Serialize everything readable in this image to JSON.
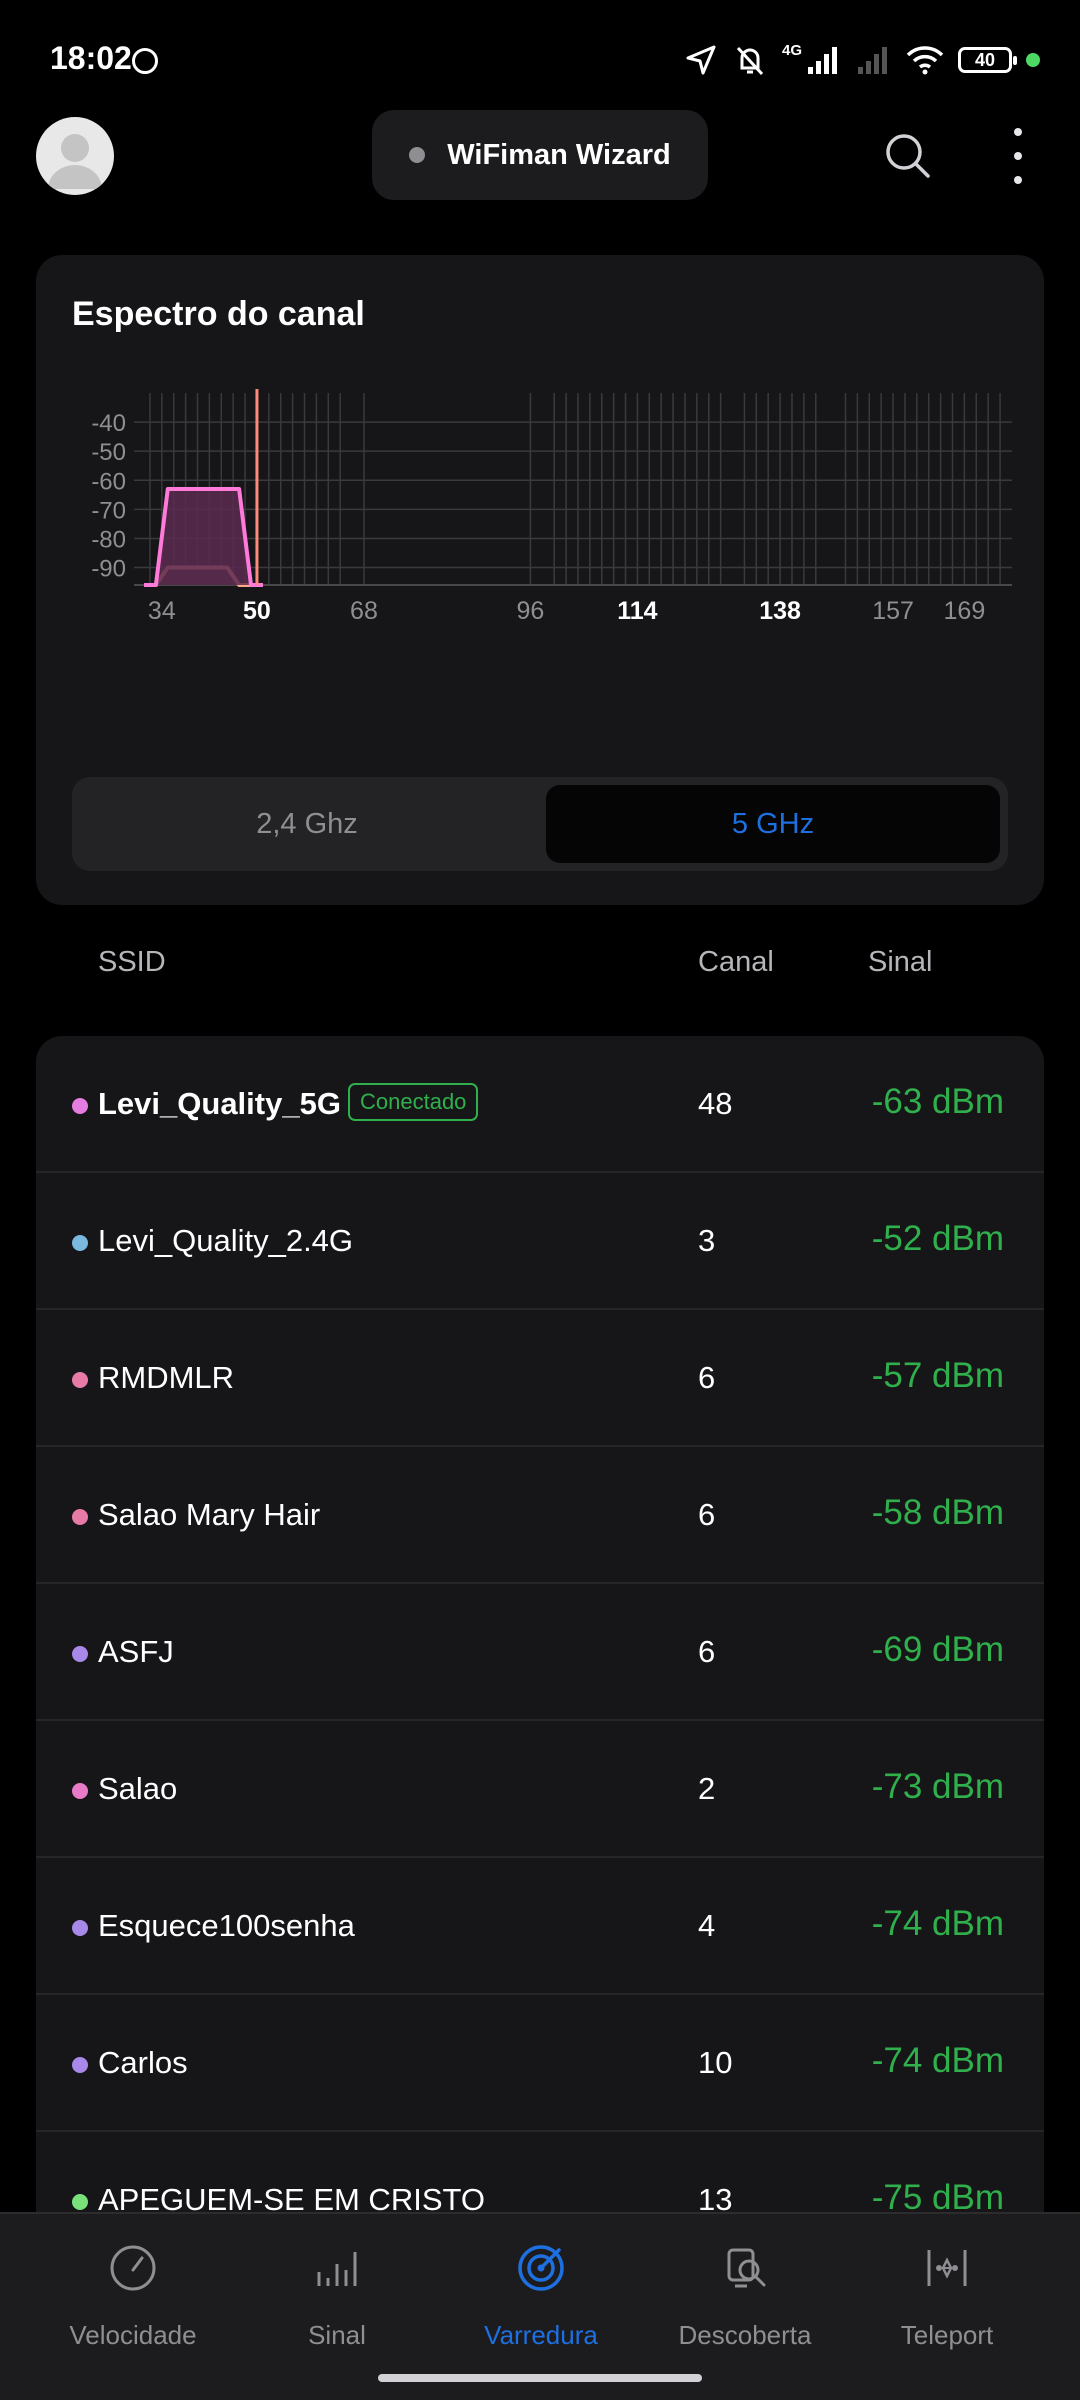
{
  "status_bar": {
    "time": "18:02",
    "network_label": "4G",
    "battery_level": "40",
    "status_dot_color": "#4cd964"
  },
  "header": {
    "avatar_icon": "user-avatar-icon",
    "wizard_label": "WiFiman Wizard",
    "search_icon": "search-icon",
    "more_icon": "more-vertical-icon"
  },
  "spectrum": {
    "title": "Espectro do canal",
    "bands": {
      "inactive_label": "2,4 Ghz",
      "active_label": "5 GHz",
      "selected": "5 GHz"
    },
    "accent_color": "#1e6fe0"
  },
  "chart_data": {
    "type": "area",
    "title": "Espectro do canal",
    "xlabel": "",
    "ylabel": "",
    "x_ticks": [
      {
        "label": "34",
        "value": 34,
        "highlight": false
      },
      {
        "label": "50",
        "value": 50,
        "highlight": true
      },
      {
        "label": "68",
        "value": 68,
        "highlight": false
      },
      {
        "label": "96",
        "value": 96,
        "highlight": false
      },
      {
        "label": "114",
        "value": 114,
        "highlight": true
      },
      {
        "label": "138",
        "value": 138,
        "highlight": true
      },
      {
        "label": "157",
        "value": 157,
        "highlight": false
      },
      {
        "label": "169",
        "value": 169,
        "highlight": false
      }
    ],
    "y_ticks": [
      -40,
      -50,
      -60,
      -70,
      -80,
      -90
    ],
    "ylim": [
      -96,
      -30
    ],
    "xlim": [
      31,
      176
    ],
    "channel_gridlines": [
      32,
      34,
      36,
      38,
      40,
      42,
      44,
      46,
      48,
      50,
      52,
      54,
      56,
      58,
      60,
      62,
      64,
      68,
      96,
      100,
      102,
      104,
      106,
      108,
      110,
      112,
      114,
      116,
      118,
      120,
      122,
      124,
      126,
      128,
      132,
      134,
      136,
      138,
      140,
      142,
      144,
      149,
      151,
      153,
      155,
      157,
      159,
      161,
      163,
      165,
      167,
      169,
      171,
      173,
      175
    ],
    "grid": true,
    "marker": {
      "channel": 50,
      "color": "#ff8a7a"
    },
    "series": [
      {
        "name": "Levi_Quality_5G",
        "color": "#ff7ad9",
        "fill": "#5a2a50",
        "x": [
          31,
          33,
          35,
          47,
          49,
          51
        ],
        "y": [
          -96,
          -96,
          -63,
          -63,
          -96,
          -96
        ]
      },
      {
        "name": "",
        "color": "#ffa98a",
        "fill": "#3a2a30",
        "x": [
          31,
          33,
          35,
          45,
          47,
          51
        ],
        "y": [
          -96,
          -96,
          -90,
          -90,
          -96,
          -96
        ]
      }
    ]
  },
  "table": {
    "headers": {
      "ssid": "SSID",
      "channel": "Canal",
      "signal": "Sinal"
    },
    "rows": [
      {
        "ssid": "Levi_Quality_5G",
        "badge": "Conectado",
        "channel": "48",
        "signal": "-63 dBm",
        "color": "#e57ce0",
        "bold": true
      },
      {
        "ssid": "Levi_Quality_2.4G",
        "badge": "",
        "channel": "3",
        "signal": "-52 dBm",
        "color": "#7ab8e0",
        "bold": false
      },
      {
        "ssid": "RMDMLR",
        "badge": "",
        "channel": "6",
        "signal": "-57 dBm",
        "color": "#e87aa8",
        "bold": false
      },
      {
        "ssid": "Salao Mary Hair",
        "badge": "",
        "channel": "6",
        "signal": "-58 dBm",
        "color": "#e87aa8",
        "bold": false
      },
      {
        "ssid": "ASFJ",
        "badge": "",
        "channel": "6",
        "signal": "-69 dBm",
        "color": "#a888e8",
        "bold": false
      },
      {
        "ssid": "Salao",
        "badge": "",
        "channel": "2",
        "signal": "-73 dBm",
        "color": "#e87ac8",
        "bold": false
      },
      {
        "ssid": "Esquece100senha",
        "badge": "",
        "channel": "4",
        "signal": "-74 dBm",
        "color": "#a888e8",
        "bold": false
      },
      {
        "ssid": "Carlos",
        "badge": "",
        "channel": "10",
        "signal": "-74 dBm",
        "color": "#a888e8",
        "bold": false
      },
      {
        "ssid": "APEGUEM-SE EM CRISTO",
        "badge": "",
        "channel": "13",
        "signal": "-75 dBm",
        "color": "#7ae07a",
        "bold": false
      }
    ],
    "signal_color": "#30b04c"
  },
  "bottom_nav": {
    "items": [
      {
        "label": "Velocidade",
        "icon": "speedometer-icon",
        "active": false
      },
      {
        "label": "Sinal",
        "icon": "signal-bars-icon",
        "active": false
      },
      {
        "label": "Varredura",
        "icon": "radar-scan-icon",
        "active": true
      },
      {
        "label": "Descoberta",
        "icon": "device-discovery-icon",
        "active": false
      },
      {
        "label": "Teleport",
        "icon": "teleport-icon",
        "active": false
      }
    ]
  }
}
